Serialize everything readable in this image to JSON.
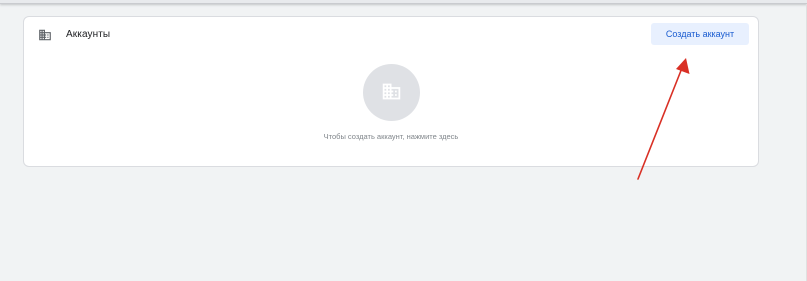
{
  "accounts_card": {
    "title": "Аккаунты",
    "title_icon": "building-icon",
    "create_button_label": "Создать аккаунт",
    "empty_state": {
      "icon": "building-icon",
      "message": "Чтобы создать аккаунт, нажмите здесь"
    }
  },
  "annotation": {
    "type": "arrow",
    "color": "#d93025"
  },
  "colors": {
    "background": "#f1f3f4",
    "card": "#ffffff",
    "button_bg": "#e8f0fe",
    "button_text": "#1a5cd0",
    "empty_circle": "#dfe1e5"
  }
}
